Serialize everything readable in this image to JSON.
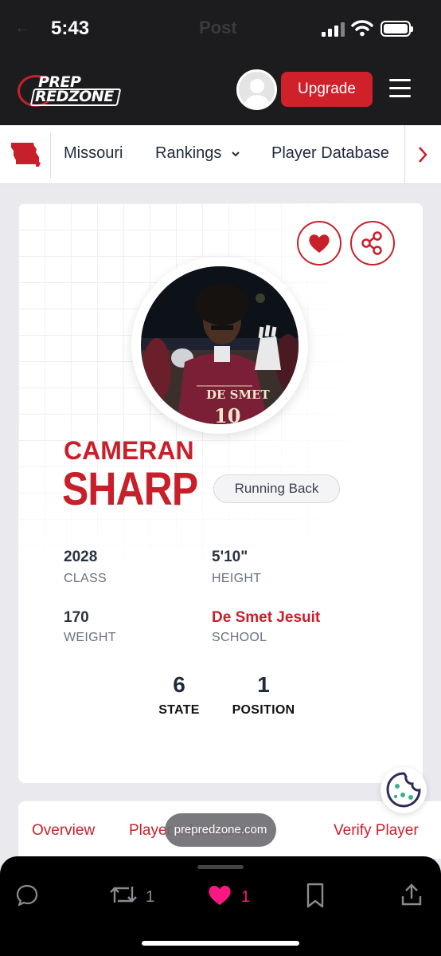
{
  "status_bar": {
    "time": "5:43",
    "ghost_title": "Post"
  },
  "header": {
    "logo_line1": "PREP",
    "logo_line2": "REDZONE",
    "upgrade_label": "Upgrade"
  },
  "nav": {
    "items": [
      "Missouri",
      "Rankings",
      "Player Database"
    ],
    "rankings_caret": "⌄",
    "more": "›"
  },
  "player": {
    "first_name": "CAMERAN",
    "last_name": "SHARP",
    "position": "Running Back",
    "jersey_text": "DE SMET",
    "stats": [
      {
        "value": "2028",
        "label": "CLASS"
      },
      {
        "value": "5'10\"",
        "label": "HEIGHT"
      },
      {
        "value": "170",
        "label": "WEIGHT"
      },
      {
        "value": "De Smet Jesuit",
        "label": "SCHOOL"
      }
    ],
    "rankings": [
      {
        "value": "6",
        "label": "STATE"
      },
      {
        "value": "1",
        "label": "POSITION"
      }
    ]
  },
  "tabs": [
    "Overview",
    "Player Information",
    "Verify Player"
  ],
  "toast": "prepredzone.com",
  "toolbar": {
    "retweet_count": "1",
    "like_count": "1"
  },
  "colors": {
    "brand_red": "#c8202a",
    "like_pink": "#f91880"
  }
}
